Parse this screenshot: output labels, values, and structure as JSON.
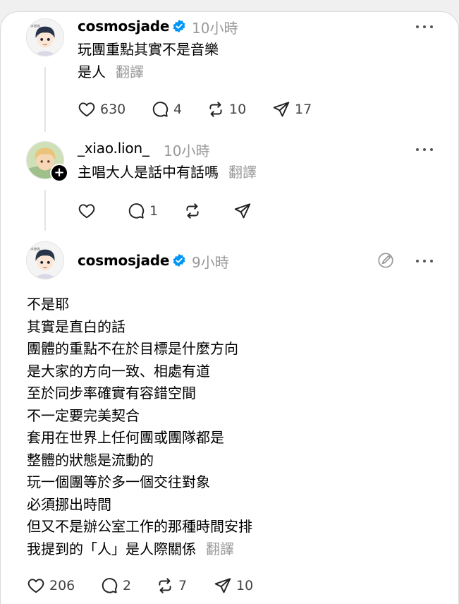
{
  "posts": [
    {
      "username": "cosmosjade",
      "verified": true,
      "time": "10小時",
      "lines": [
        "玩團重點其實不是音樂",
        "是人"
      ],
      "translate": "翻譯",
      "stats": {
        "likes": "630",
        "replies": "4",
        "reposts": "10",
        "shares": "17"
      }
    },
    {
      "username": "_xiao.lion_",
      "verified": false,
      "time": "10小時",
      "lines": [
        "主唱大人是話中有話嗎"
      ],
      "translate": "翻譯",
      "stats": {
        "likes": "",
        "replies": "1",
        "reposts": "",
        "shares": ""
      }
    },
    {
      "username": "cosmosjade",
      "verified": true,
      "time": "9小時",
      "lines": [
        "不是耶",
        "其實是直白的話",
        "團體的重點不在於目標是什麼方向",
        "是大家的方向一致、相處有道",
        "至於同步率確實有容錯空間",
        "不一定要完美契合",
        "套用在世界上任何團或團隊都是",
        "整體的狀態是流動的",
        "玩一個團等於多一個交往對象",
        "必須挪出時間",
        "但又不是辦公室工作的那種時間安排",
        "我提到的「人」是人際關係"
      ],
      "translate": "翻譯",
      "stats": {
        "likes": "206",
        "replies": "2",
        "reposts": "7",
        "shares": "10"
      }
    }
  ],
  "icons": {
    "more": "more-horizontal-icon",
    "like": "heart-icon",
    "reply": "comment-icon",
    "repost": "repost-icon",
    "share": "send-icon",
    "verified": "verified-badge-icon",
    "follow": "plus-icon",
    "edit": "edit-icon"
  },
  "colors": {
    "verified": "#0095f6",
    "muted": "#999999",
    "divider": "#e3e3e3"
  }
}
